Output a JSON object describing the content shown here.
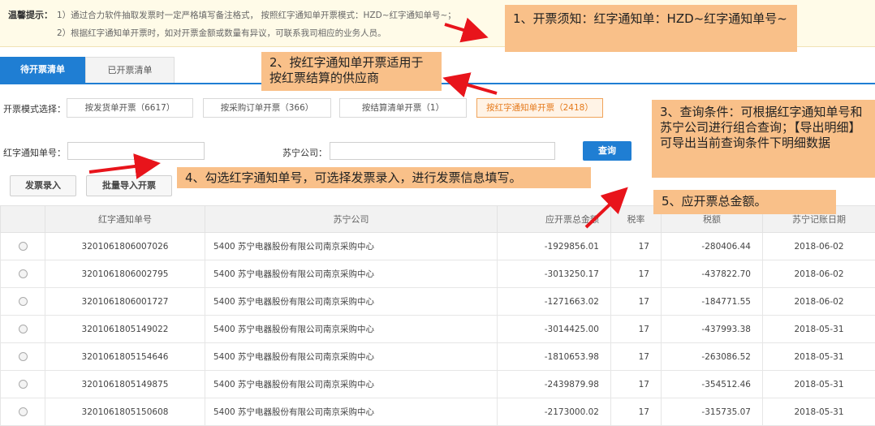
{
  "notice": {
    "label": "温馨提示：",
    "line1": "1）通过合力软件抽取发票时一定严格填写备注格式，  按照红字通知单开票模式：HZD~红字通知单号~；",
    "line2": "2）根据红字通知单开票时，如对开票金额或数量有异议，可联系我司相应的业务人员。"
  },
  "tabs": [
    {
      "label": "待开票清单",
      "active": true
    },
    {
      "label": "已开票清单",
      "active": false
    }
  ],
  "mode": {
    "label": "开票模式选择：",
    "options": [
      {
        "label": "按发货单开票（6617）",
        "active": false
      },
      {
        "label": "按采购订单开票（366）",
        "active": false
      },
      {
        "label": "按结算清单开票（1）",
        "active": false
      },
      {
        "label": "按红字通知单开票（2418）",
        "active": true
      }
    ]
  },
  "query": {
    "notice_no_label": "红字通知单号：",
    "notice_no_value": "",
    "company_label": "苏宁公司：",
    "company_value": "",
    "search_label": "查询"
  },
  "actions": {
    "invoice_entry": "发票录入",
    "batch_import": "批量导入开票"
  },
  "table": {
    "headers": [
      "",
      "红字通知单号",
      "苏宁公司",
      "应开票总金额",
      "税率",
      "税额",
      "苏宁记账日期"
    ],
    "rows": [
      {
        "no": "3201061806007026",
        "company": "5400 苏宁电器股份有限公司南京采购中心",
        "amount": "-1929856.01",
        "rate": "17",
        "tax": "-280406.44",
        "date": "2018-06-02"
      },
      {
        "no": "3201061806002795",
        "company": "5400 苏宁电器股份有限公司南京采购中心",
        "amount": "-3013250.17",
        "rate": "17",
        "tax": "-437822.70",
        "date": "2018-06-02"
      },
      {
        "no": "3201061806001727",
        "company": "5400 苏宁电器股份有限公司南京采购中心",
        "amount": "-1271663.02",
        "rate": "17",
        "tax": "-184771.55",
        "date": "2018-06-02"
      },
      {
        "no": "3201061805149022",
        "company": "5400 苏宁电器股份有限公司南京采购中心",
        "amount": "-3014425.00",
        "rate": "17",
        "tax": "-437993.38",
        "date": "2018-05-31"
      },
      {
        "no": "3201061805154646",
        "company": "5400 苏宁电器股份有限公司南京采购中心",
        "amount": "-1810653.98",
        "rate": "17",
        "tax": "-263086.52",
        "date": "2018-05-31"
      },
      {
        "no": "3201061805149875",
        "company": "5400 苏宁电器股份有限公司南京采购中心",
        "amount": "-2439879.98",
        "rate": "17",
        "tax": "-354512.46",
        "date": "2018-05-31"
      },
      {
        "no": "3201061805150608",
        "company": "5400 苏宁电器股份有限公司南京采购中心",
        "amount": "-2173000.02",
        "rate": "17",
        "tax": "-315735.07",
        "date": "2018-05-31"
      }
    ]
  },
  "callouts": {
    "c1": "1、开票须知：红字通知单：HZD~红字通知单号~",
    "c2": "2、按红字通知单开票适用于按红票结算的供应商",
    "c3": "3、查询条件：可根据红字通知单号和苏宁公司进行组合查询；【导出明细】可导出当前查询条件下明细数据",
    "c4": "4、勾选红字通知单号，可选择发票录入，进行发票信息填写。",
    "c5": "5、应开票总金额。"
  },
  "colors": {
    "primary": "#1f7ed3",
    "callout_bg": "#f9c089",
    "arrow": "#e8141b",
    "active_mode": "#e57a1c"
  }
}
